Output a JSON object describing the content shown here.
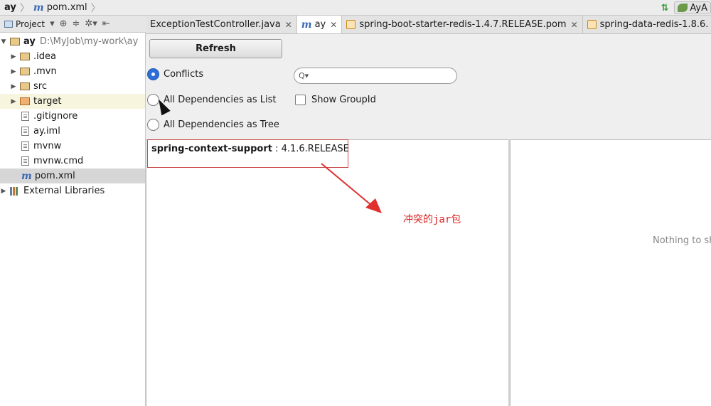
{
  "breadcrumb": {
    "root": "ay",
    "file": "pom.xml",
    "run_config": "AyA"
  },
  "project_panel": {
    "title": "Project",
    "root_label": "ay",
    "root_path": "D:\\MyJob\\my-work\\ay",
    "items": [
      {
        "label": ".idea",
        "type": "folder"
      },
      {
        "label": ".mvn",
        "type": "folder"
      },
      {
        "label": "src",
        "type": "folder"
      },
      {
        "label": "target",
        "type": "folder"
      },
      {
        "label": ".gitignore",
        "type": "file"
      },
      {
        "label": "ay.iml",
        "type": "file"
      },
      {
        "label": "mvnw",
        "type": "file"
      },
      {
        "label": "mvnw.cmd",
        "type": "file"
      },
      {
        "label": "pom.xml",
        "type": "maven"
      },
      {
        "label": "External Libraries",
        "type": "library"
      }
    ]
  },
  "tabs": [
    {
      "label": "ExceptionTestController.java",
      "active": false
    },
    {
      "label": "ay",
      "active": true
    },
    {
      "label": "spring-boot-starter-redis-1.4.7.RELEASE.pom",
      "active": false
    },
    {
      "label": "spring-data-redis-1.8.6.",
      "active": false
    }
  ],
  "analyzer": {
    "refresh_label": "Refresh",
    "options": [
      {
        "label": "Conflicts",
        "selected": true
      },
      {
        "label": "All Dependencies as List",
        "selected": false
      },
      {
        "label": "All Dependencies as Tree",
        "selected": false
      }
    ],
    "show_group_id_label": "Show GroupId",
    "search_placeholder": "Q▾"
  },
  "conflicts": [
    {
      "artifact": "spring-context-support",
      "version": " : 4.1.6.RELEASE"
    }
  ],
  "annotation_text": "冲突的jar包",
  "empty_panel_text": "Nothing to sh",
  "colors": {
    "annotation": "#dd2222",
    "selection": "#2d6fd6"
  }
}
